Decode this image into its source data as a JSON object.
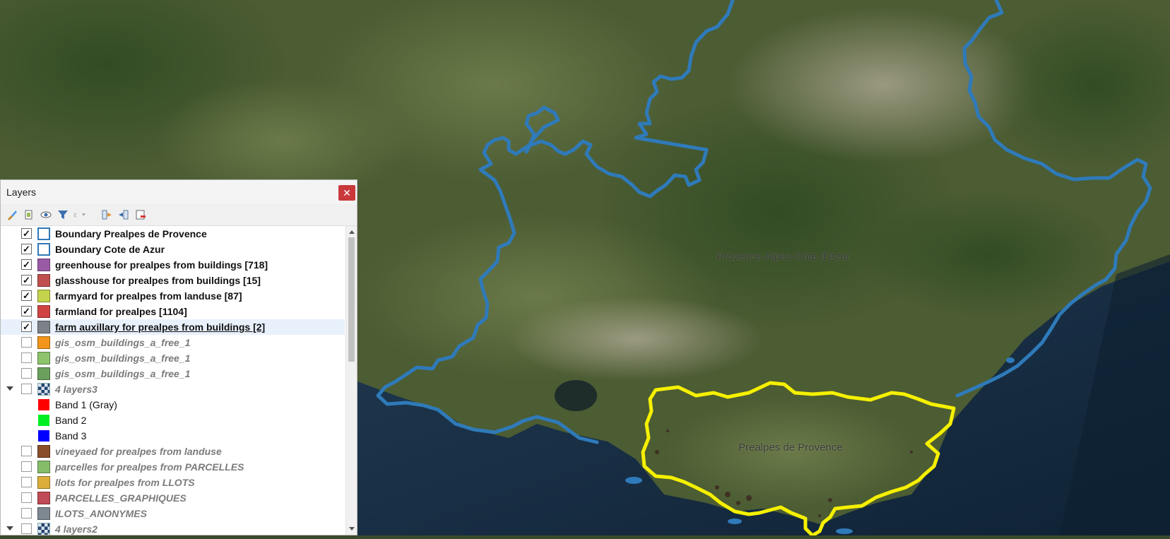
{
  "map": {
    "labels": [
      "Provence-Alpes-Côte d'Azur",
      "Prealpes de Provence"
    ]
  },
  "panel": {
    "title": "Layers",
    "close_icon": "close-icon",
    "toolbar": [
      {
        "name": "style-manager-icon"
      },
      {
        "name": "add-group-icon"
      },
      {
        "name": "visibility-icon"
      },
      {
        "name": "filter-legend-icon"
      },
      {
        "name": "filter-expression-icon"
      },
      {
        "name": "expand-all-icon"
      },
      {
        "name": "collapse-all-icon"
      },
      {
        "name": "remove-layer-icon"
      }
    ],
    "layers": [
      {
        "label": "Boundary Prealpes de Provence",
        "checked": true,
        "symbol": "boundary",
        "style": "bold"
      },
      {
        "label": "Boundary Cote de Azur",
        "checked": true,
        "symbol": "boundary",
        "style": "bold"
      },
      {
        "label": "greenhouse for prealpes from buildings [718]",
        "checked": true,
        "color": "#9a5aa6",
        "style": "bold"
      },
      {
        "label": "glasshouse for prealpes from buildings [15]",
        "checked": true,
        "color": "#c0504f",
        "style": "bold"
      },
      {
        "label": "farmyard for prealpes from landuse [87]",
        "checked": true,
        "color": "#c3d34b",
        "style": "bold"
      },
      {
        "label": "farmland for prealpes [1104]",
        "checked": true,
        "color": "#d04444",
        "style": "bold"
      },
      {
        "label": "farm auxillary for prealpes from buildings [2]",
        "checked": true,
        "color": "#7c8288",
        "style": "bold",
        "current": true
      },
      {
        "label": "gis_osm_buildings_a_free_1",
        "checked": false,
        "color": "#f2961b",
        "style": "off"
      },
      {
        "label": "gis_osm_buildings_a_free_1",
        "checked": false,
        "color": "#8dc36c",
        "style": "off"
      },
      {
        "label": "gis_osm_buildings_a_free_1",
        "checked": false,
        "color": "#6ba05c",
        "style": "off"
      },
      {
        "label": "4 layers3",
        "checked": false,
        "symbol": "raster",
        "style": "off",
        "expander": true
      },
      {
        "label": "Band 1 (Gray)",
        "band": true,
        "color": "#ff0000"
      },
      {
        "label": "Band 2",
        "band": true,
        "color": "#00ee22"
      },
      {
        "label": "Band 3",
        "band": true,
        "color": "#0000ff"
      },
      {
        "label": "vineyaed for prealpes from landuse",
        "checked": false,
        "color": "#8a4e2a",
        "style": "off"
      },
      {
        "label": "parcelles for prealpes from PARCELLES",
        "checked": false,
        "color": "#86bd6a",
        "style": "off"
      },
      {
        "label": "llots for prealpes from LLOTS",
        "checked": false,
        "color": "#dcae3a",
        "style": "off"
      },
      {
        "label": "PARCELLES_GRAPHIQUES",
        "checked": false,
        "color": "#c04a55",
        "style": "off"
      },
      {
        "label": "ILOTS_ANONYMES",
        "checked": false,
        "color": "#7e8890",
        "style": "off"
      },
      {
        "label": "4 layers2",
        "checked": false,
        "symbol": "raster",
        "style": "off",
        "expander": true
      }
    ]
  }
}
